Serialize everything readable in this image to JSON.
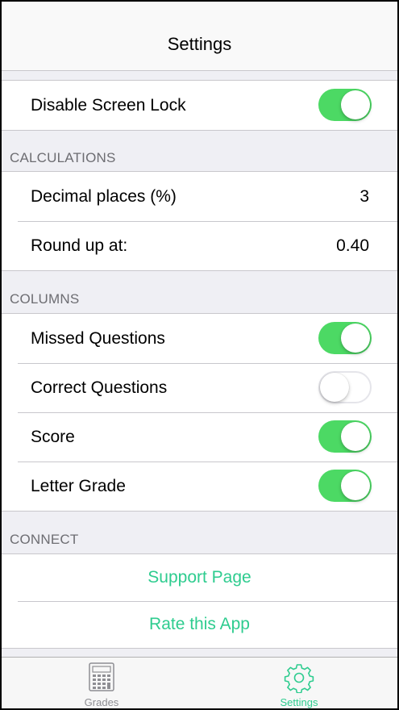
{
  "navbar": {
    "title": "Settings"
  },
  "general": {
    "disable_screen_lock": {
      "label": "Disable Screen Lock",
      "on": true
    }
  },
  "calculations": {
    "header": "CALCULATIONS",
    "decimal_places": {
      "label": "Decimal places (%)",
      "value": "3"
    },
    "round_up": {
      "label": "Round up at:",
      "value": "0.40"
    }
  },
  "columns": {
    "header": "COLUMNS",
    "items": [
      {
        "label": "Missed Questions",
        "on": true
      },
      {
        "label": "Correct Questions",
        "on": false
      },
      {
        "label": "Score",
        "on": true
      },
      {
        "label": "Letter Grade",
        "on": true
      }
    ]
  },
  "connect": {
    "header": "CONNECT",
    "support_page": "Support Page",
    "rate_app": "Rate this App"
  },
  "tabbar": {
    "tabs": [
      {
        "label": "Grades",
        "icon": "calculator-icon",
        "active": false
      },
      {
        "label": "Settings",
        "icon": "gear-icon",
        "active": true
      }
    ]
  },
  "colors": {
    "accent": "#2ecc8f",
    "switch_on": "#4cd964",
    "inactive": "#8e8e93"
  }
}
